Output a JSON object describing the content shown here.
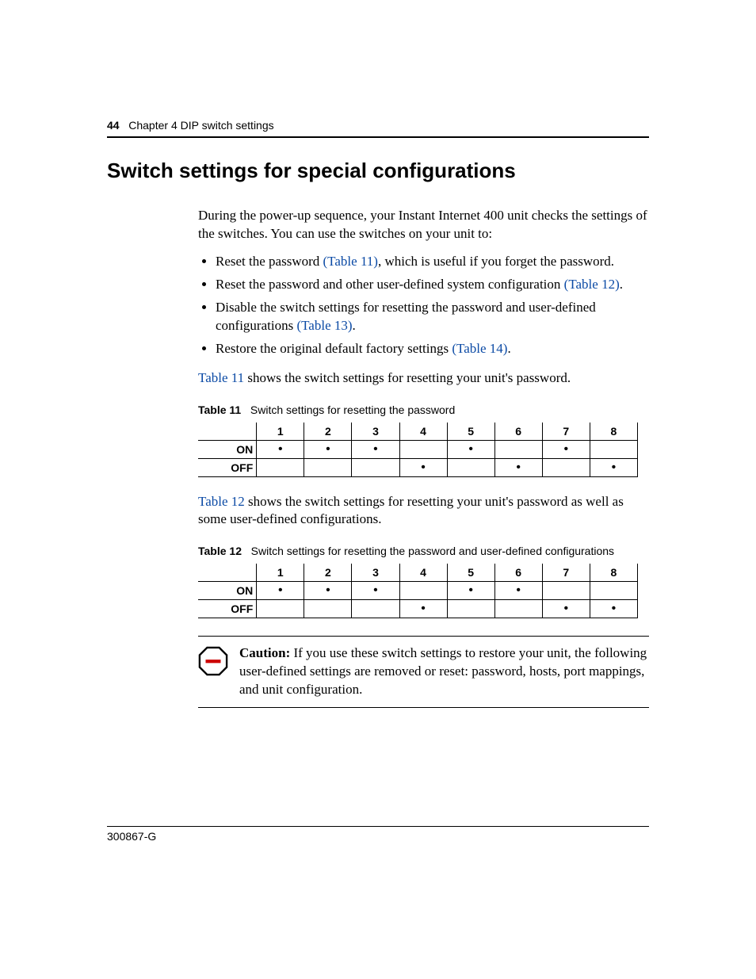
{
  "header": {
    "page_number": "44",
    "chapter": "Chapter 4  DIP switch settings"
  },
  "section_title": "Switch settings for special configurations",
  "intro_para": "During the power-up sequence, your Instant Internet 400 unit checks the settings of the switches. You can use the switches on your unit to:",
  "bullets": {
    "b1a": "Reset the password ",
    "b1link": "(Table 11)",
    "b1b": ", which is useful if you forget the password.",
    "b2a": "Reset the password and other user-defined system configuration ",
    "b2link": "(Table 12)",
    "b2b": ".",
    "b3a": "Disable the switch settings for resetting the password and user-defined configurations ",
    "b3link": "(Table 13)",
    "b3b": ".",
    "b4a": "Restore the original default factory settings ",
    "b4link": "(Table 14)",
    "b4b": "."
  },
  "para_t11_lead_link": "Table 11",
  "para_t11_lead_rest": " shows the switch settings for resetting your unit's password.",
  "table11": {
    "label": "Table 11",
    "caption": "Switch settings for resetting the password",
    "columns": [
      "1",
      "2",
      "3",
      "4",
      "5",
      "6",
      "7",
      "8"
    ],
    "row_on_label": "ON",
    "row_off_label": "OFF",
    "on": [
      "•",
      "•",
      "•",
      "",
      "•",
      "",
      "•",
      ""
    ],
    "off": [
      "",
      "",
      "",
      "•",
      "",
      "•",
      "",
      "•"
    ]
  },
  "para_t12_lead_link": "Table 12",
  "para_t12_lead_rest": " shows the switch settings for resetting your unit's password as well as some user-defined configurations.",
  "table12": {
    "label": "Table 12",
    "caption": "Switch settings for resetting the password and user-defined configurations",
    "columns": [
      "1",
      "2",
      "3",
      "4",
      "5",
      "6",
      "7",
      "8"
    ],
    "row_on_label": "ON",
    "row_off_label": "OFF",
    "on": [
      "•",
      "•",
      "•",
      "",
      "•",
      "•",
      "",
      ""
    ],
    "off": [
      "",
      "",
      "",
      "•",
      "",
      "",
      "•",
      "•"
    ]
  },
  "caution": {
    "label": "Caution:",
    "text": " If you use these switch settings to restore your unit, the following user-defined settings are removed or reset: password, hosts, port mappings, and unit configuration."
  },
  "footer": "300867-G"
}
